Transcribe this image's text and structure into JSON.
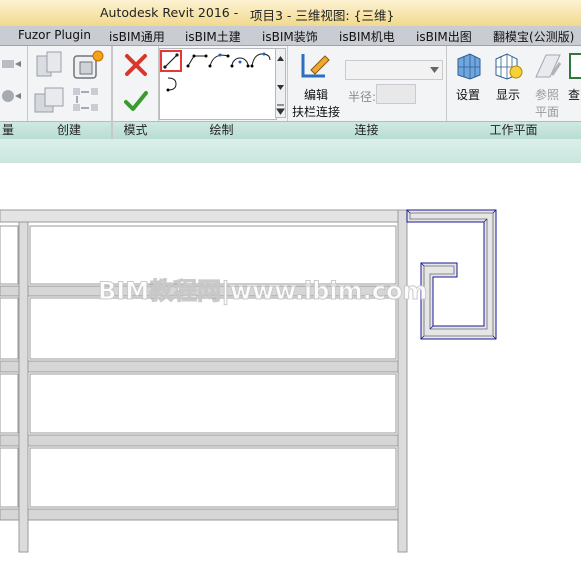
{
  "titlebar": {
    "app": "Autodesk Revit 2016 -",
    "document": "项目3 - 三维视图: {三维}"
  },
  "tabs": [
    "Fuzor Plugin",
    "isBIM通用",
    "isBIM土建",
    "isBIM装饰",
    "isBIM机电",
    "isBIM出图",
    "翻模宝(公测版)"
  ],
  "ribbon": {
    "panels": {
      "left_partial": "量",
      "create": "创建",
      "mode": "模式",
      "draw": "绘制",
      "connect": "连接",
      "workplane": "工作平面"
    },
    "edit_label_1": "编辑",
    "edit_label_2": "扶栏连接",
    "radius_label": "半径:",
    "set_label": "设置",
    "show_label": "显示",
    "ref_plane_label_1": "参照",
    "ref_plane_label_2": "平面",
    "view_label_partial": "查"
  },
  "watermark": "BIM教程网|www.ibim.com",
  "colors": {
    "title_bg": "#f6e4a8",
    "panel_label_bg": "#c4e3da",
    "selection": "#e53935",
    "sketch_line": "#1a1aa8"
  }
}
